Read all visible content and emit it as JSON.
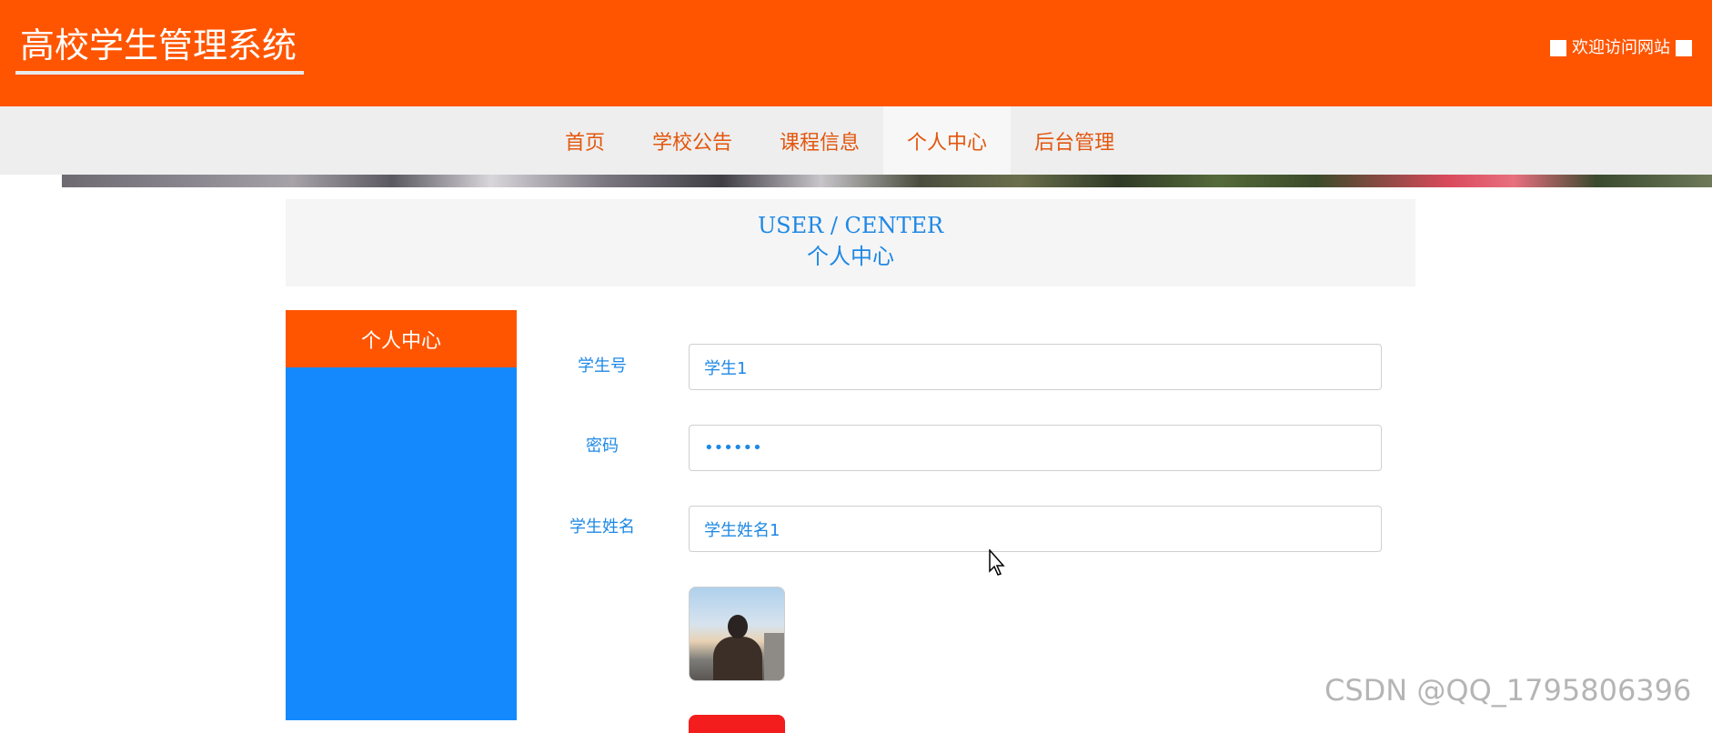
{
  "header": {
    "title": "高校学生管理系统",
    "welcome": "欢迎访问网站"
  },
  "nav": {
    "items": [
      {
        "label": "首页"
      },
      {
        "label": "学校公告"
      },
      {
        "label": "课程信息"
      },
      {
        "label": "个人中心"
      },
      {
        "label": "后台管理"
      }
    ],
    "active": "个人中心"
  },
  "page_header": {
    "en": "USER / CENTER",
    "cn": "个人中心"
  },
  "sidebar": {
    "title": "个人中心"
  },
  "form": {
    "student_id_label": "学生号",
    "student_id_value": "学生1",
    "password_label": "密码",
    "password_value": "••••••",
    "name_label": "学生姓名",
    "name_value": "学生姓名1"
  },
  "watermark": "CSDN @QQ_1795806396",
  "colors": {
    "brand": "#ff5500",
    "nav_bg": "#eeeeee",
    "accent_blue": "#1489fd",
    "text_blue": "#1e88e5",
    "danger": "#f31d1d"
  }
}
